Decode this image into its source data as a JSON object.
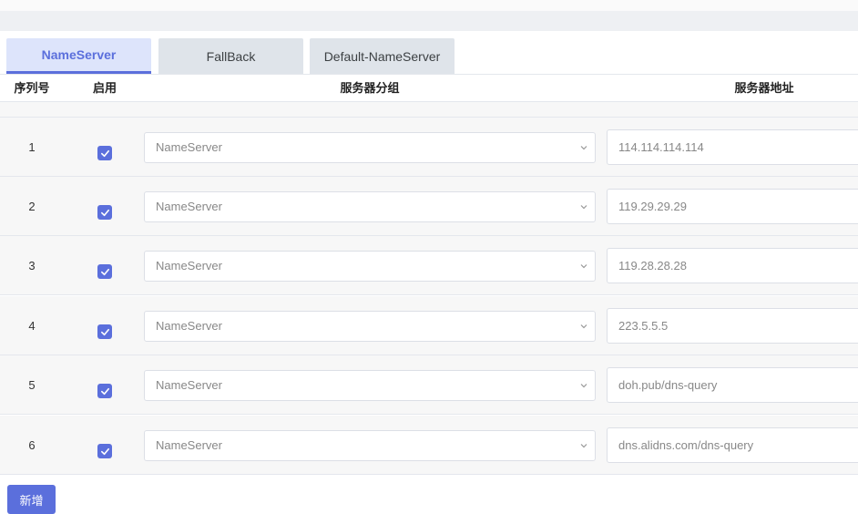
{
  "tabs": [
    {
      "label": "NameServer",
      "active": true
    },
    {
      "label": "FallBack",
      "active": false
    },
    {
      "label": "Default-NameServer",
      "active": false
    }
  ],
  "table": {
    "headers": {
      "index": "序列号",
      "enabled": "启用",
      "group": "服务器分组",
      "address": "服务器地址"
    },
    "rows": [
      {
        "index": "1",
        "enabled": true,
        "group": "NameServer",
        "address": "114.114.114.114"
      },
      {
        "index": "2",
        "enabled": true,
        "group": "NameServer",
        "address": "119.29.29.29"
      },
      {
        "index": "3",
        "enabled": true,
        "group": "NameServer",
        "address": "119.28.28.28"
      },
      {
        "index": "4",
        "enabled": true,
        "group": "NameServer",
        "address": "223.5.5.5"
      },
      {
        "index": "5",
        "enabled": true,
        "group": "NameServer",
        "address": "doh.pub/dns-query"
      },
      {
        "index": "6",
        "enabled": true,
        "group": "NameServer",
        "address": "dns.alidns.com/dns-query"
      }
    ]
  },
  "actions": {
    "add_label": "新增"
  },
  "colors": {
    "accent": "#5b6fdc"
  }
}
